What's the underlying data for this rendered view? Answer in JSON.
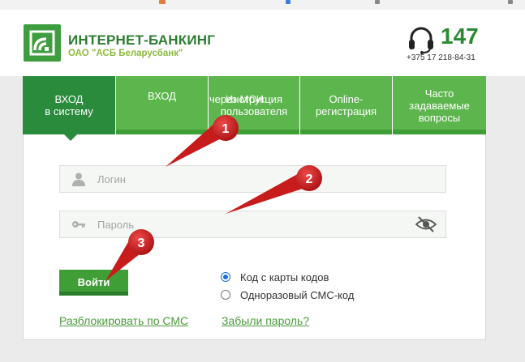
{
  "brand": {
    "title": "ИНТЕРНЕТ-БАНКИНГ",
    "subtitle": "ОАО \"АСБ Беларусбанк\"",
    "phone_short": "147",
    "phone_full": "+375 17 218-84-31"
  },
  "tabs": [
    {
      "label_line1": "ВХОД",
      "label_line2": "в систему"
    },
    {
      "label_line1": "ВХОД",
      "label_line2": ""
    },
    {
      "label_line1": "Инструкция",
      "label_line2": "пользователя",
      "overlay_text": "через МСИ"
    },
    {
      "label_line1": "Online-",
      "label_line2": "регистрация"
    },
    {
      "label_line1": "Часто",
      "label_line2": "задаваемые",
      "label_line3": "вопросы"
    }
  ],
  "form": {
    "login_placeholder": "Логин",
    "password_placeholder": "Пароль",
    "submit_label": "Войти",
    "options": [
      {
        "label": "Код с карты кодов",
        "selected": true
      },
      {
        "label": "Одноразовый СМС-код",
        "selected": false
      }
    ],
    "unlock_link": "Разблокировать по СМС",
    "forgot_link": "Забыли пароль?"
  },
  "callouts": [
    "1",
    "2",
    "3"
  ],
  "colors": {
    "active_tab": "#2a8b3c",
    "tab": "#5db54d",
    "brand_green": "#2d7d32",
    "callout_red": "#d11f1f"
  }
}
